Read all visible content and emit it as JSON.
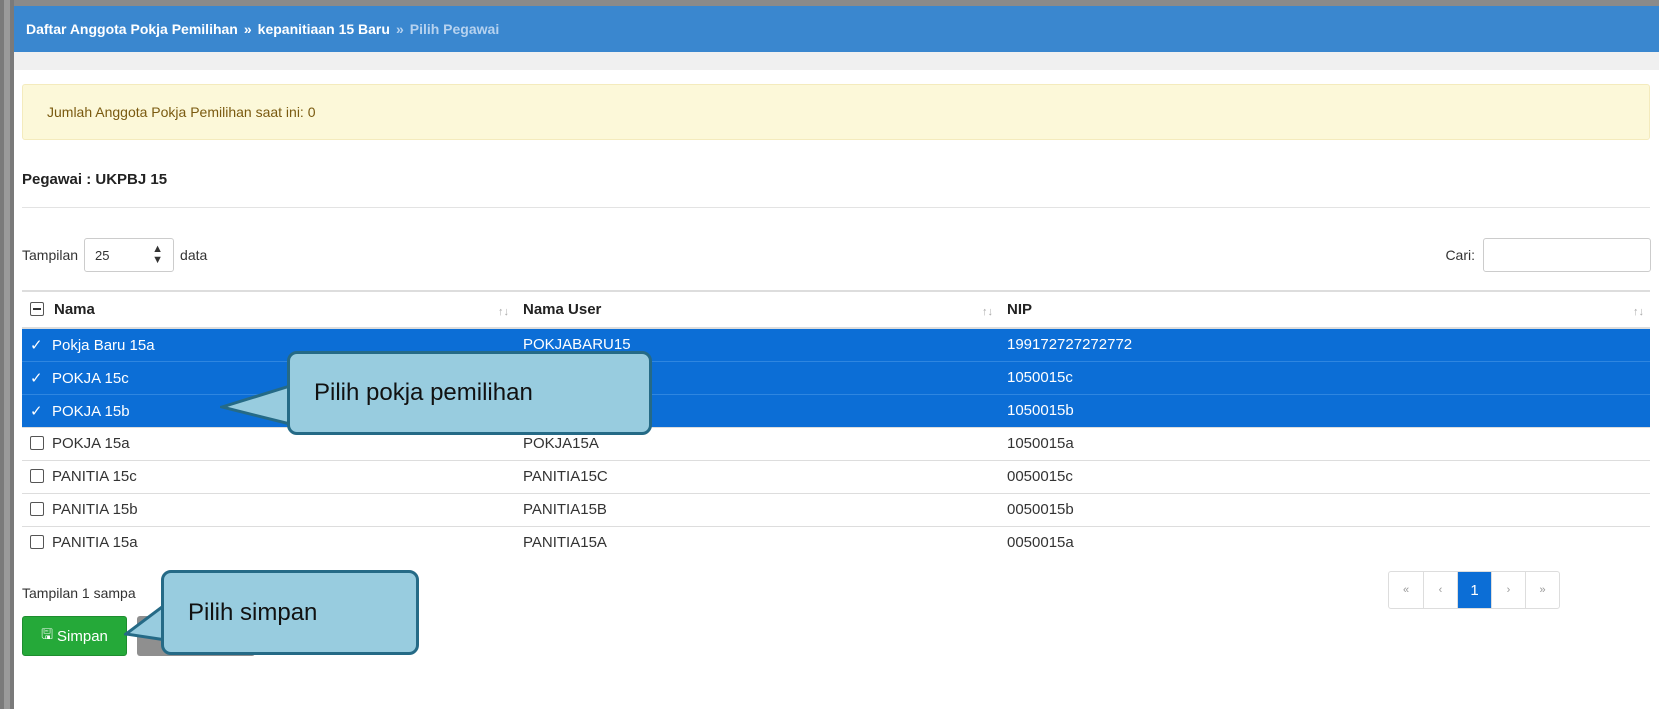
{
  "breadcrumb": {
    "item1": "Daftar Anggota Pokja Pemilihan",
    "sep": "»",
    "item2": "kepanitiaan 15 Baru",
    "item3": "Pilih Pegawai"
  },
  "alert": {
    "text": "Jumlah Anggota Pokja Pemilihan saat ini: 0"
  },
  "pegawai": {
    "label": "Pegawai : UKPBJ 15"
  },
  "length": {
    "prefix": "Tampilan",
    "value": "25",
    "suffix": "data"
  },
  "search": {
    "label": "Cari:",
    "value": ""
  },
  "table": {
    "headers": [
      "Nama",
      "Nama User",
      "NIP"
    ],
    "rows": [
      {
        "nama": "Pokja Baru 15a",
        "user": "POKJABARU15",
        "nip": "199172727272772",
        "selected": true
      },
      {
        "nama": "POKJA 15c",
        "user": "",
        "nip": "1050015c",
        "selected": true
      },
      {
        "nama": "POKJA 15b",
        "user": "",
        "nip": "1050015b",
        "selected": true
      },
      {
        "nama": "POKJA 15a",
        "user": "POKJA15A",
        "nip": "1050015a",
        "selected": false
      },
      {
        "nama": "PANITIA 15c",
        "user": "PANITIA15C",
        "nip": "0050015c",
        "selected": false
      },
      {
        "nama": "PANITIA 15b",
        "user": "PANITIA15B",
        "nip": "0050015b",
        "selected": false
      },
      {
        "nama": "PANITIA 15a",
        "user": "PANITIA15A",
        "nip": "0050015a",
        "selected": false
      }
    ]
  },
  "info": {
    "text": "Tampilan 1 sampa"
  },
  "pager": {
    "first": "«",
    "prev": "‹",
    "current": "1",
    "next": "›",
    "last": "»"
  },
  "buttons": {
    "save": "Simpan"
  },
  "callouts": {
    "select_pokja": "Pilih pokja pemilihan",
    "select_save": "Pilih simpan"
  },
  "colors": {
    "header": "#3a87cf",
    "selected_row": "#0c6ed6",
    "save_button": "#25a939",
    "callout_fill": "#98ccdf",
    "callout_border": "#256a86"
  }
}
